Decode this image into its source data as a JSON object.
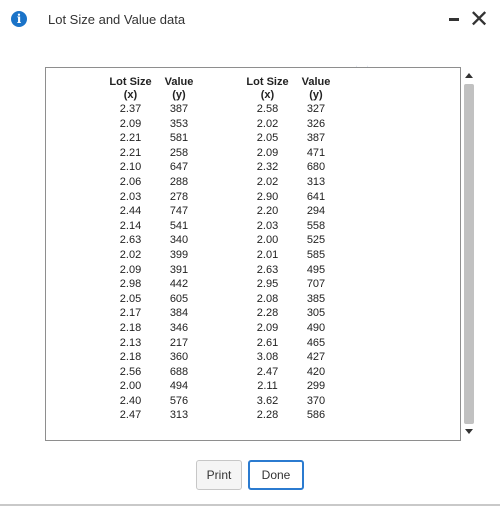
{
  "window": {
    "title": "Lot Size and Value data",
    "info_icon": "i",
    "close_symbol": "✕"
  },
  "table": {
    "headers": [
      {
        "line1": "Lot Size",
        "line2": "(x)"
      },
      {
        "line1": "Value",
        "line2": "(y)"
      },
      {
        "line1": "Lot Size",
        "line2": "(x)"
      },
      {
        "line1": "Value",
        "line2": "(y)"
      }
    ],
    "rows": [
      [
        "2.37",
        "387",
        "2.58",
        "327"
      ],
      [
        "2.09",
        "353",
        "2.02",
        "326"
      ],
      [
        "2.21",
        "581",
        "2.05",
        "387"
      ],
      [
        "2.21",
        "258",
        "2.09",
        "471"
      ],
      [
        "2.10",
        "647",
        "2.32",
        "680"
      ],
      [
        "2.06",
        "288",
        "2.02",
        "313"
      ],
      [
        "2.03",
        "278",
        "2.90",
        "641"
      ],
      [
        "2.44",
        "747",
        "2.20",
        "294"
      ],
      [
        "2.14",
        "541",
        "2.03",
        "558"
      ],
      [
        "2.63",
        "340",
        "2.00",
        "525"
      ],
      [
        "2.02",
        "399",
        "2.01",
        "585"
      ],
      [
        "2.09",
        "391",
        "2.63",
        "495"
      ],
      [
        "2.98",
        "442",
        "2.95",
        "707"
      ],
      [
        "2.05",
        "605",
        "2.08",
        "385"
      ],
      [
        "2.17",
        "384",
        "2.28",
        "305"
      ],
      [
        "2.18",
        "346",
        "2.09",
        "490"
      ],
      [
        "2.13",
        "217",
        "2.61",
        "465"
      ],
      [
        "2.18",
        "360",
        "3.08",
        "427"
      ],
      [
        "2.56",
        "688",
        "2.47",
        "420"
      ],
      [
        "2.00",
        "494",
        "2.11",
        "299"
      ],
      [
        "2.40",
        "576",
        "3.62",
        "370"
      ],
      [
        "2.47",
        "313",
        "2.28",
        "586"
      ]
    ]
  },
  "buttons": {
    "print_label": "Print",
    "done_label": "Done"
  },
  "colors": {
    "accent": "#2b7bd0",
    "info_icon": "#1a73c8"
  }
}
